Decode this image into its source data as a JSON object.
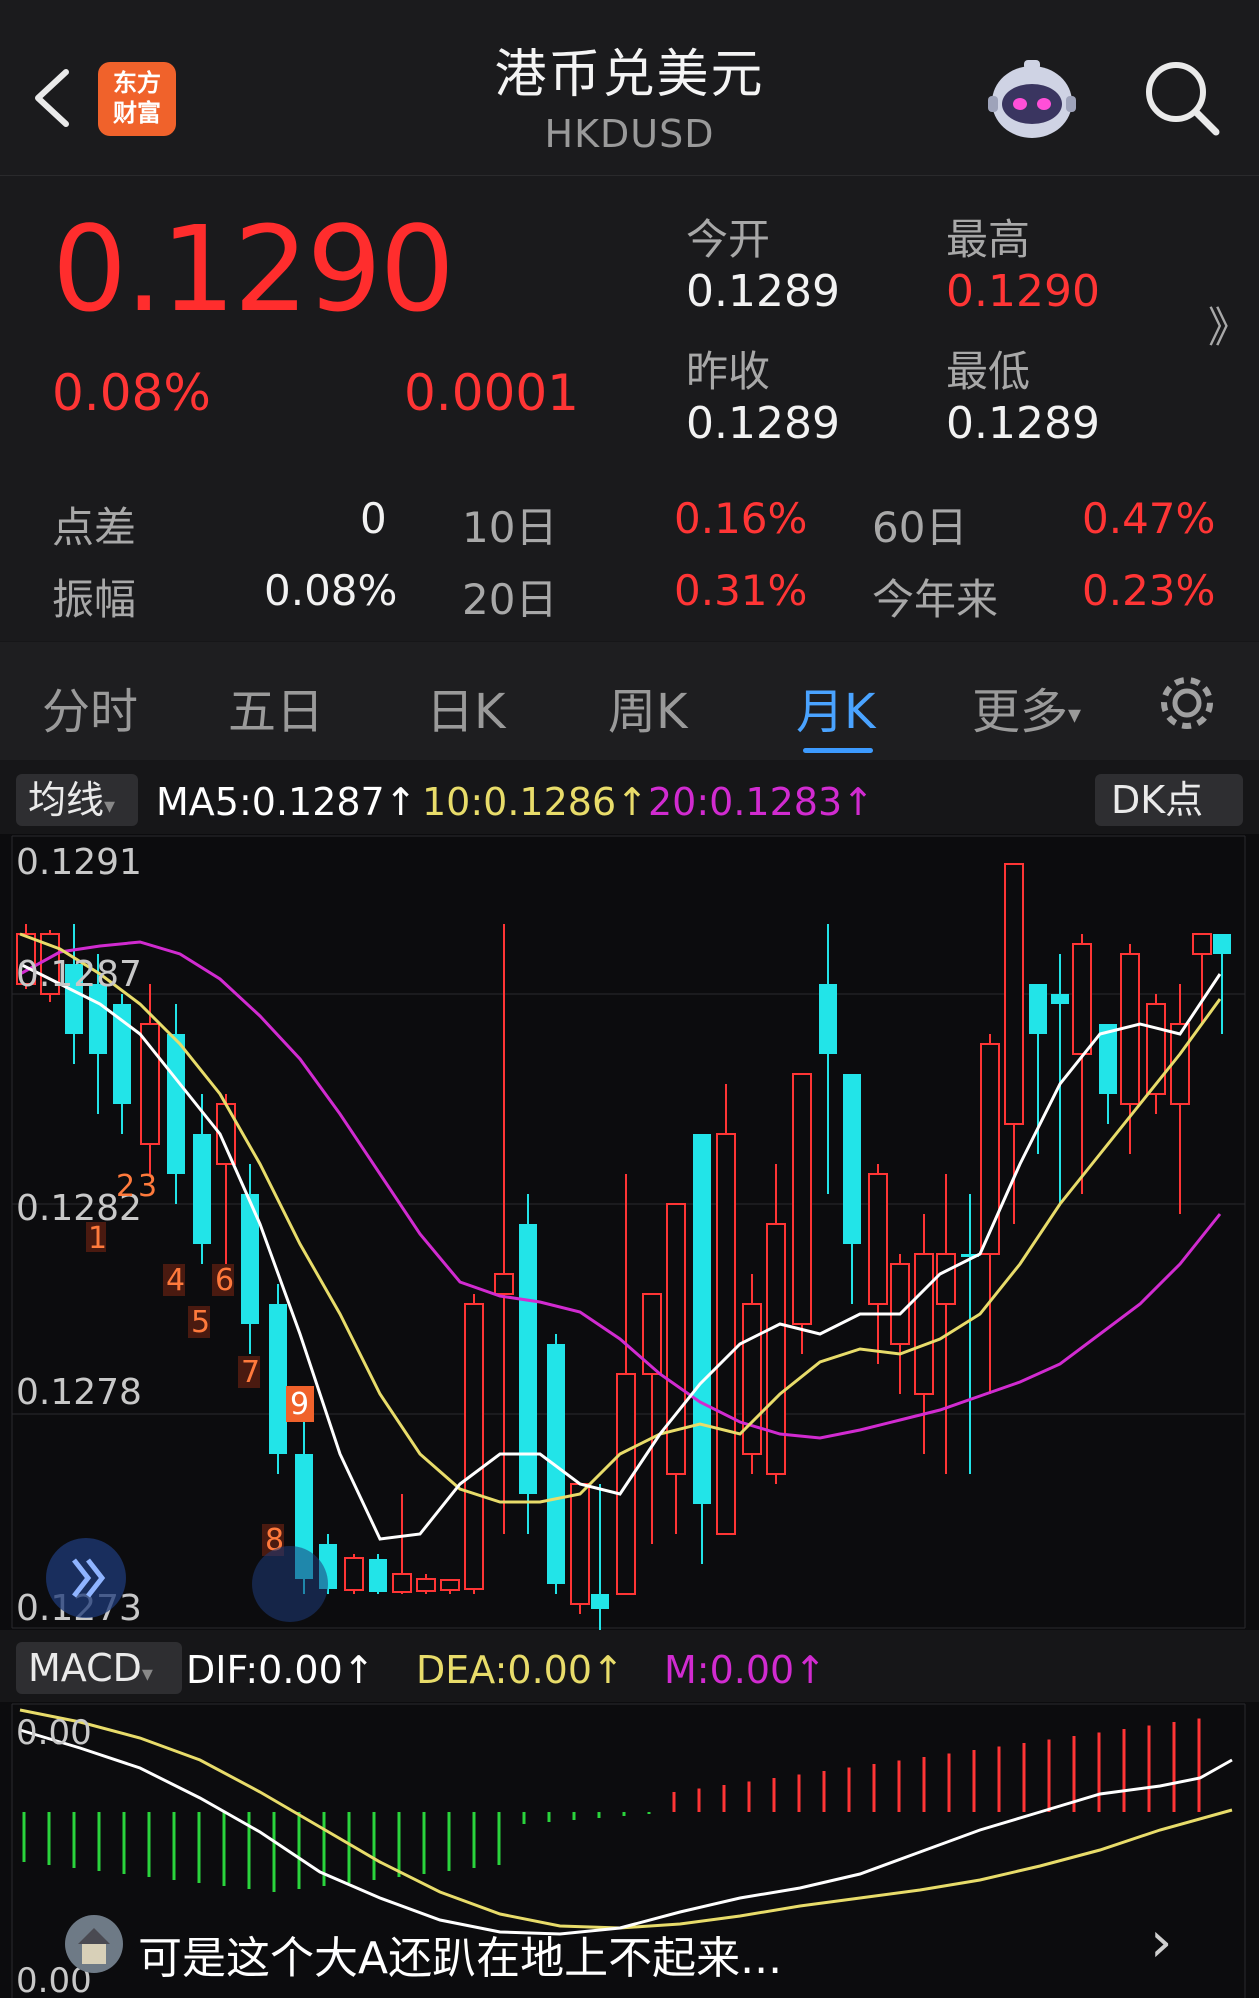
{
  "header": {
    "title": "港币兑美元",
    "subtitle": "HKDUSD",
    "logo_line1": "东方",
    "logo_line2": "财富"
  },
  "quote": {
    "price": "0.1290",
    "change_pct": "0.08%",
    "change": "0.0001",
    "open_label": "今开",
    "open": "0.1289",
    "high_label": "最高",
    "high": "0.1290",
    "prev_close_label": "昨收",
    "prev_close": "0.1289",
    "low_label": "最低",
    "low": "0.1289",
    "spread_label": "点差",
    "spread": "0",
    "amplitude_label": "振幅",
    "amplitude": "0.08%",
    "d10_label": "10日",
    "d10": "0.16%",
    "d20_label": "20日",
    "d20": "0.31%",
    "d60_label": "60日",
    "d60": "0.47%",
    "ytd_label": "今年来",
    "ytd": "0.23%",
    "more_glyph": "》"
  },
  "tabs": [
    "分时",
    "五日",
    "日K",
    "周K",
    "月K",
    "更多"
  ],
  "active_tab": "月K",
  "more_caret": "▾",
  "kline_bar": {
    "select_label": "均线",
    "caret": "▾",
    "ma5": "MA5:0.1287↑",
    "ma10": "10:0.1286↑",
    "ma20": "20:0.1283↑",
    "dk_label": "DK点"
  },
  "price_axis": [
    "0.1291",
    "0.1287",
    "0.1282",
    "0.1278",
    "0.1273"
  ],
  "td_labels": [
    "1",
    "2",
    "3",
    "4",
    "5",
    "6",
    "7",
    "8",
    "9"
  ],
  "macd_bar": {
    "select_label": "MACD",
    "caret": "▾",
    "dif": "DIF:0.00↑",
    "dea": "DEA:0.00↑",
    "m": "M:0.00↑"
  },
  "macd_axis": [
    "0.00",
    "0.00"
  ],
  "comment": {
    "text": "可是这个大A还趴在地上不起来...",
    "arrow": "›"
  },
  "colors": {
    "up": "#ff3535",
    "down": "#22e4e8",
    "ma5": "#ffffff",
    "ma10": "#e8dc6a",
    "ma20": "#d12bd0",
    "accent": "#3d9bff"
  }
}
